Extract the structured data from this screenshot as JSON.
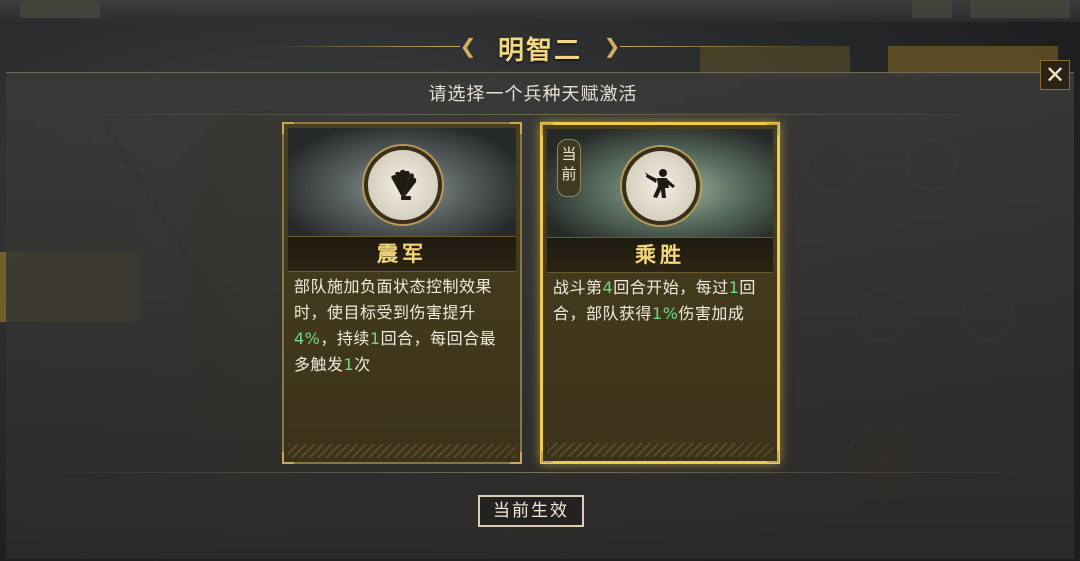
{
  "modal": {
    "title": "明智二",
    "subtitle": "请选择一个兵种天赋激活",
    "close_icon": "close-icon"
  },
  "cards": [
    {
      "name": "震军",
      "icon": "fan-feather-icon",
      "selected": false,
      "desc": [
        {
          "t": "部队施加负面状态控制效果时，使目标受到伤害提升"
        },
        {
          "t": "4%",
          "hl": true
        },
        {
          "t": "，持续"
        },
        {
          "t": "1",
          "hl": true
        },
        {
          "t": "回合，每回合最多触发"
        },
        {
          "t": "1",
          "hl": true
        },
        {
          "t": "次"
        }
      ]
    },
    {
      "name": "乘胜",
      "icon": "warrior-silhouette-icon",
      "selected": true,
      "tag": "当前",
      "desc": [
        {
          "t": "战斗第"
        },
        {
          "t": "4",
          "hl": true
        },
        {
          "t": "回合开始，每过"
        },
        {
          "t": "1",
          "hl": true
        },
        {
          "t": "回合，部队获得"
        },
        {
          "t": "1%",
          "hl": true
        },
        {
          "t": "伤害加成"
        }
      ]
    }
  ],
  "footer": {
    "status_label": "当前生效"
  },
  "colors": {
    "accent_gold": "#f1cc49",
    "highlight_green": "#6fd88a"
  }
}
